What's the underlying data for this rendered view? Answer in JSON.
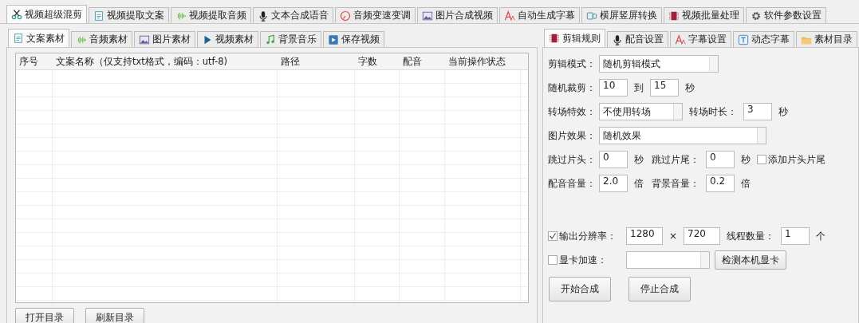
{
  "main_tabs": [
    {
      "label": "视频超级混剪",
      "selected": true
    },
    {
      "label": "视频提取文案",
      "selected": false
    },
    {
      "label": "视频提取音频",
      "selected": false
    },
    {
      "label": "文本合成语音",
      "selected": false
    },
    {
      "label": "音频变速变调",
      "selected": false
    },
    {
      "label": "图片合成视频",
      "selected": false
    },
    {
      "label": "自动生成字幕",
      "selected": false
    },
    {
      "label": "横屏竖屏转换",
      "selected": false
    },
    {
      "label": "视频批量处理",
      "selected": false
    },
    {
      "label": "软件参数设置",
      "selected": false
    }
  ],
  "left_panel": {
    "tabs": [
      {
        "label": "文案素材",
        "selected": true
      },
      {
        "label": "音频素材",
        "selected": false
      },
      {
        "label": "图片素材",
        "selected": false
      },
      {
        "label": "视频素材",
        "selected": false
      },
      {
        "label": "背景音乐",
        "selected": false
      },
      {
        "label": "保存视频",
        "selected": false
      }
    ],
    "table": {
      "columns": [
        "序号",
        "文案名称（仅支持txt格式，编码：utf-8)",
        "路径",
        "字数",
        "配音",
        "当前操作状态"
      ]
    },
    "buttons": [
      "打开目录",
      "刷新目录"
    ]
  },
  "right_panel": {
    "tabs": [
      {
        "label": "剪辑规则",
        "selected": true
      },
      {
        "label": "配音设置",
        "selected": false
      },
      {
        "label": "字幕设置",
        "selected": false
      },
      {
        "label": "动态字幕",
        "selected": false
      },
      {
        "label": "素材目录",
        "selected": false
      }
    ],
    "form_rows": [
      [
        {
          "kind": "label",
          "text": "剪辑模式："
        },
        {
          "kind": "select",
          "value": "随机剪辑模式"
        }
      ],
      [
        {
          "kind": "label",
          "text": "随机裁剪："
        },
        {
          "kind": "input",
          "value": "10"
        },
        {
          "kind": "unit",
          "text": "到"
        },
        {
          "kind": "input",
          "value": "15"
        },
        {
          "kind": "unit",
          "text": "秒"
        }
      ],
      [
        {
          "kind": "label",
          "text": "转场特效："
        },
        {
          "kind": "select",
          "value": "不使用转场"
        },
        {
          "kind": "unit",
          "text": "转场时长："
        },
        {
          "kind": "input",
          "value": "3"
        },
        {
          "kind": "unit",
          "text": "秒"
        }
      ],
      [
        {
          "kind": "label",
          "text": "图片效果："
        },
        {
          "kind": "select",
          "value": "随机效果"
        }
      ],
      [
        {
          "kind": "label",
          "text": "跳过片头："
        },
        {
          "kind": "input",
          "value": "0"
        },
        {
          "kind": "unit",
          "text": "秒"
        },
        {
          "kind": "unit",
          "text": "跳过片尾："
        },
        {
          "kind": "input",
          "value": "0"
        },
        {
          "kind": "unit",
          "text": "秒"
        },
        {
          "kind": "checkbox",
          "text": "添加片头片尾",
          "checked": false
        }
      ],
      [
        {
          "kind": "label",
          "text": "配音音量："
        },
        {
          "kind": "input",
          "value": "2.0"
        },
        {
          "kind": "unit",
          "text": "倍"
        },
        {
          "kind": "unit",
          "text": "背景音量："
        },
        {
          "kind": "input",
          "value": "0.2"
        },
        {
          "kind": "unit",
          "text": "倍"
        }
      ]
    ],
    "output_rows": [
      [
        {
          "kind": "checkbox",
          "text": "输出分辨率：",
          "checked": true
        },
        {
          "kind": "input",
          "value": "1280"
        },
        {
          "kind": "unit",
          "text": "×"
        },
        {
          "kind": "input",
          "value": "720"
        },
        {
          "kind": "unit",
          "text": "线程数量："
        },
        {
          "kind": "input",
          "value": "1"
        },
        {
          "kind": "unit",
          "text": "个"
        }
      ],
      [
        {
          "kind": "checkbox",
          "text": "显卡加速：",
          "checked": false
        },
        {
          "kind": "select"
        },
        {
          "kind": "button",
          "text": "检测本机显卡"
        }
      ]
    ],
    "buttons": [
      "开始合成",
      "停止合成"
    ]
  }
}
